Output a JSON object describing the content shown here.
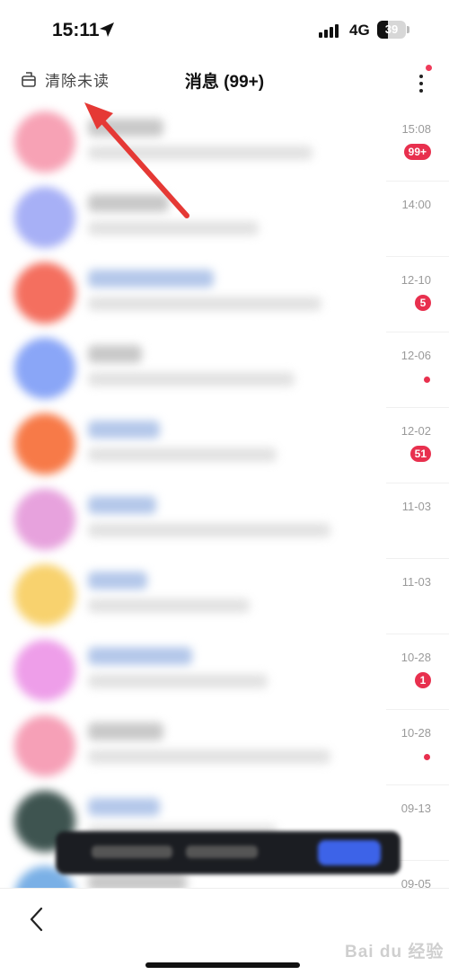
{
  "status_bar": {
    "time": "15:11",
    "location_icon": "location-arrow-icon",
    "network": "4G",
    "battery": 39
  },
  "header": {
    "clear_label": "清除未读",
    "clear_icon": "broom-icon",
    "title": "消息 (99+)",
    "more_icon": "more-vertical-icon"
  },
  "conversations": [
    {
      "time": "15:08",
      "badge": "99+",
      "dot": false,
      "avatar_color": "#f7a2b5",
      "name_color": "#c8c8c8",
      "name_w": 84,
      "preview_w": 250
    },
    {
      "time": "14:00",
      "badge": "",
      "dot": false,
      "avatar_color": "#a7b0f6",
      "name_color": "#c8c8c8",
      "name_w": 90,
      "preview_w": 190
    },
    {
      "time": "12-10",
      "badge": "5",
      "dot": false,
      "avatar_color": "#f46f5f",
      "name_color": "#b3c7ea",
      "name_w": 140,
      "preview_w": 260
    },
    {
      "time": "12-06",
      "badge": "",
      "dot": true,
      "avatar_color": "#8aa6f7",
      "name_color": "#c8c8c8",
      "name_w": 60,
      "preview_w": 230
    },
    {
      "time": "12-02",
      "badge": "51",
      "dot": false,
      "avatar_color": "#f77a48",
      "name_color": "#b3c7ea",
      "name_w": 80,
      "preview_w": 210
    },
    {
      "time": "11-03",
      "badge": "",
      "dot": false,
      "avatar_color": "#e7a2dd",
      "name_color": "#b3c7ea",
      "name_w": 76,
      "preview_w": 270
    },
    {
      "time": "11-03",
      "badge": "",
      "dot": false,
      "avatar_color": "#f8d26e",
      "name_color": "#b3c7ea",
      "name_w": 66,
      "preview_w": 180
    },
    {
      "time": "10-28",
      "badge": "1",
      "dot": false,
      "avatar_color": "#ee9ee9",
      "name_color": "#b3c7ea",
      "name_w": 116,
      "preview_w": 200
    },
    {
      "time": "10-28",
      "badge": "",
      "dot": true,
      "avatar_color": "#f6a0b7",
      "name_color": "#c8c8c8",
      "name_w": 84,
      "preview_w": 270
    },
    {
      "time": "09-13",
      "badge": "",
      "dot": false,
      "avatar_color": "#3e5450",
      "name_color": "#b3c7ea",
      "name_w": 80,
      "preview_w": 210
    },
    {
      "time": "09-05",
      "badge": "",
      "dot": false,
      "avatar_color": "#7ab0e6",
      "name_color": "#c8c8c8",
      "name_w": 110,
      "preview_w": 160
    }
  ],
  "bottom_bar": {
    "back_icon": "chevron-left-icon"
  },
  "colors": {
    "badge": "#e8304e",
    "annotation_arrow": "#e53935"
  },
  "watermark": "Bai du 经验"
}
